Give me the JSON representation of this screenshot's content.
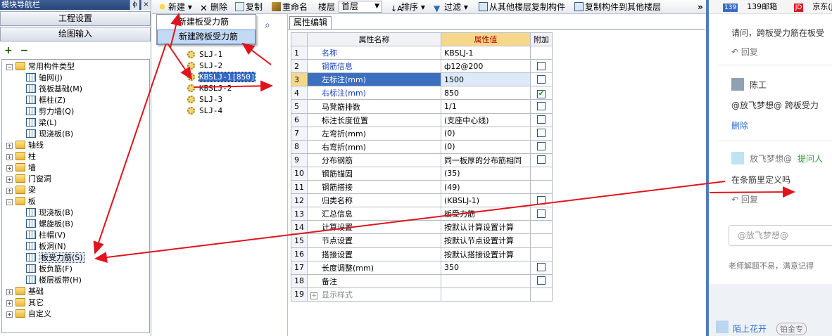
{
  "nav": {
    "title": "模块导航栏",
    "pin": "ɸ",
    "close": "×",
    "btn_project": "工程设置",
    "btn_drawing": "绘图输入",
    "toolbar_expand": "+",
    "toolbar_collapse": "−",
    "tree": {
      "common": "常用构件类型",
      "common_items": [
        "轴网(J)",
        "筏板基础(M)",
        "框柱(Z)",
        "剪力墙(Q)",
        "梁(L)",
        "现浇板(B)"
      ],
      "groups_a": [
        "轴线",
        "柱",
        "墙",
        "门窗洞",
        "梁"
      ],
      "slab": "板",
      "slab_items": [
        "现浇板(B)",
        "螺旋板(B)",
        "柱帽(V)",
        "板洞(N)",
        "板受力筋(S)",
        "板负筋(F)",
        "楼层板带(H)"
      ],
      "groups_b": [
        "基础",
        "其它",
        "自定义"
      ]
    }
  },
  "toolbar": {
    "new": "新建",
    "delete": "删除",
    "copy": "复制",
    "rename": "重命名",
    "floor_label": "楼层",
    "floor_value": "首层",
    "sort": "排序",
    "filter": "过滤",
    "copy_from": "从其他楼层复制构件",
    "copy_to": "复制构件到其他楼层",
    "more": "»"
  },
  "dropdown": {
    "items": [
      "新建板受力筋",
      "新建跨板受力筋"
    ]
  },
  "components": [
    "SLJ-1",
    "SLJ-2",
    "KBSLJ-1[850]",
    "KBSLJ-2",
    "SLJ-3",
    "SLJ-4"
  ],
  "prop": {
    "tab": "属性编辑",
    "col_name": "属性名称",
    "col_value": "属性值",
    "col_extra": "附加",
    "rows": [
      {
        "no": "1",
        "name": "名称",
        "value": "KBSLJ-1",
        "cb": "none",
        "blue": true
      },
      {
        "no": "2",
        "name": "钢筋信息",
        "value": "ф12@200",
        "cb": "off",
        "blue": true
      },
      {
        "no": "3",
        "name": "左标注(mm)",
        "value": "1500",
        "cb": "off",
        "blue": true
      },
      {
        "no": "4",
        "name": "右标注(mm)",
        "value": "850",
        "cb": "on",
        "blue": true
      },
      {
        "no": "5",
        "name": "马凳筋排数",
        "value": "1/1",
        "cb": "off",
        "blue": false
      },
      {
        "no": "6",
        "name": "标注长度位置",
        "value": "(支座中心线)",
        "cb": "off",
        "blue": false
      },
      {
        "no": "7",
        "name": "左弯折(mm)",
        "value": "(0)",
        "cb": "off",
        "blue": false
      },
      {
        "no": "8",
        "name": "右弯折(mm)",
        "value": "(0)",
        "cb": "off",
        "blue": false
      },
      {
        "no": "9",
        "name": "分布钢筋",
        "value": "同一板厚的分布筋相同",
        "cb": "off",
        "blue": false
      },
      {
        "no": "10",
        "name": "钢筋锚固",
        "value": "(35)",
        "cb": "none",
        "blue": false
      },
      {
        "no": "11",
        "name": "钢筋搭接",
        "value": "(49)",
        "cb": "none",
        "blue": false
      },
      {
        "no": "12",
        "name": "归类名称",
        "value": "(KBSLJ-1)",
        "cb": "off",
        "blue": false
      },
      {
        "no": "13",
        "name": "汇总信息",
        "value": "板受力筋",
        "cb": "off",
        "blue": false
      },
      {
        "no": "14",
        "name": "计算设置",
        "value": "按默认计算设置计算",
        "cb": "none",
        "blue": false
      },
      {
        "no": "15",
        "name": "节点设置",
        "value": "按默认节点设置计算",
        "cb": "none",
        "blue": false
      },
      {
        "no": "16",
        "name": "搭接设置",
        "value": "按默认搭接设置计算",
        "cb": "none",
        "blue": false
      },
      {
        "no": "17",
        "name": "长度调整(mm)",
        "value": "350",
        "cb": "off",
        "blue": false
      },
      {
        "no": "18",
        "name": "备注",
        "value": "",
        "cb": "off",
        "blue": false
      }
    ],
    "expand_no": "19",
    "expand_label": "显示样式"
  },
  "qa": {
    "bm_mail": "139邮箱",
    "bm_jd_badge": "JD",
    "bm_jd": "京东(JD.",
    "q_text": "请问，跨板受力筋在板受",
    "reply1": "回复",
    "user1": "陈工",
    "msg1": "@放飞梦想@ 跨板受力",
    "delete": "删除",
    "user2": "放飞梦想@",
    "asker": "提问人",
    "msg2": "在条筋里定义吗",
    "reply2": "回复",
    "input_placeholder": "@放飞梦想@",
    "footer": "老师解题不易，满意记得",
    "user3": "陌上花开",
    "user3_tag": "铂金专"
  },
  "colors": {
    "arrow": "#e0141e",
    "selection": "#316ac5",
    "header_accent": "#f7d78a"
  }
}
